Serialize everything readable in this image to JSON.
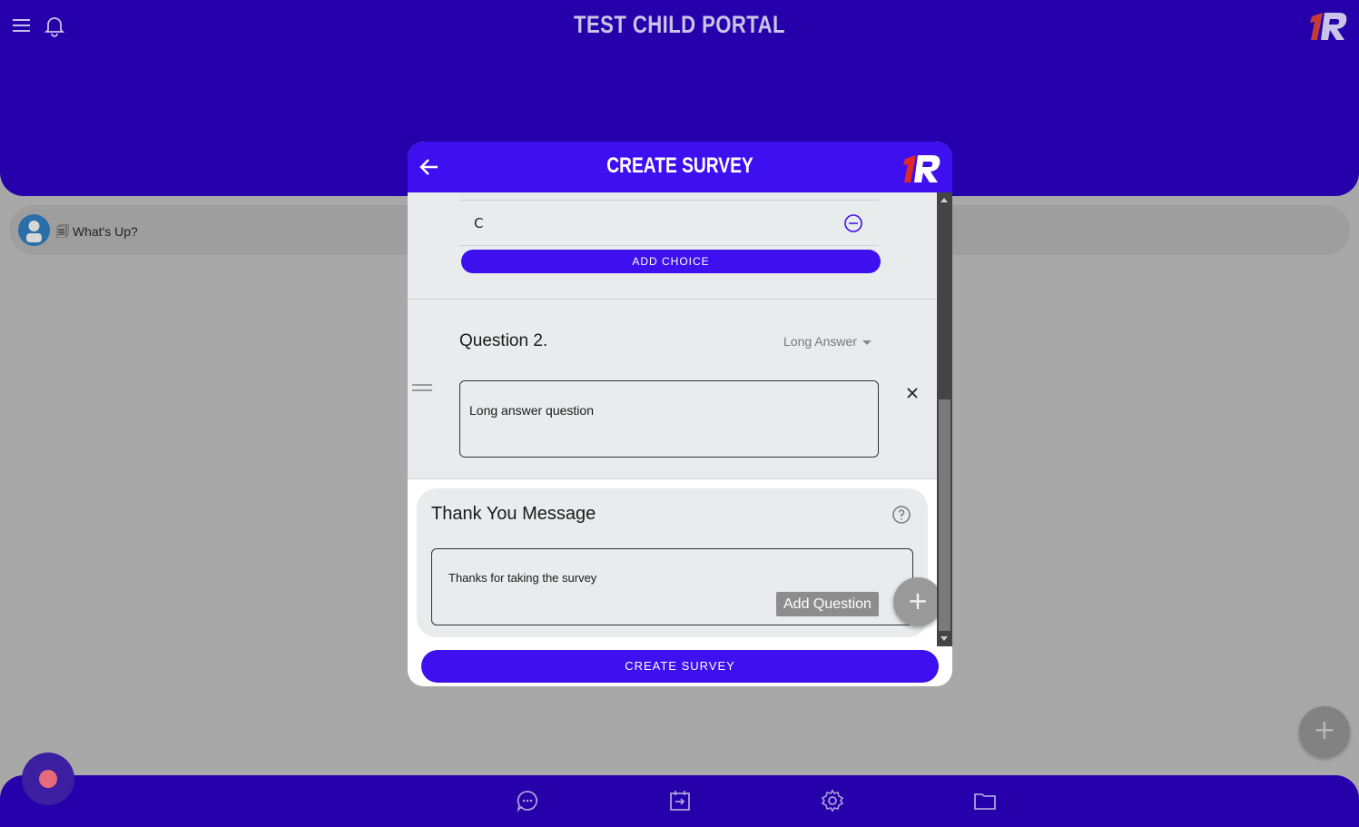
{
  "app": {
    "title": "TEST CHILD PORTAL",
    "brand_logo": "1R-logo"
  },
  "header": {
    "left_icons": [
      "menu-icon",
      "bell-icon"
    ]
  },
  "feed": {
    "item_text": "🗐 What's Up?",
    "avatar_icon": "user-avatar"
  },
  "modal": {
    "title": "CREATE SURVEY",
    "back_icon": "arrow-left-icon",
    "choices": [
      {
        "label": "C"
      }
    ],
    "add_choice_label": "ADD CHOICE",
    "question": {
      "label": "Question 2.",
      "type": "Long Answer",
      "text": "Long answer question"
    },
    "thanks": {
      "title": "Thank You Message",
      "text": "Thanks for taking the survey"
    },
    "add_question_label": "Add Question",
    "add_question_icon": "+",
    "submit_label": "CREATE SURVEY"
  },
  "page_fab_icon": "+",
  "bottom_nav": [
    "chat-icon",
    "calendar-icon",
    "settings-icon",
    "folder-icon"
  ],
  "colors": {
    "primary": "#2600aa",
    "button": "#3e10f0",
    "overlay": "#a8a8a8",
    "record": "#e56a7a"
  }
}
